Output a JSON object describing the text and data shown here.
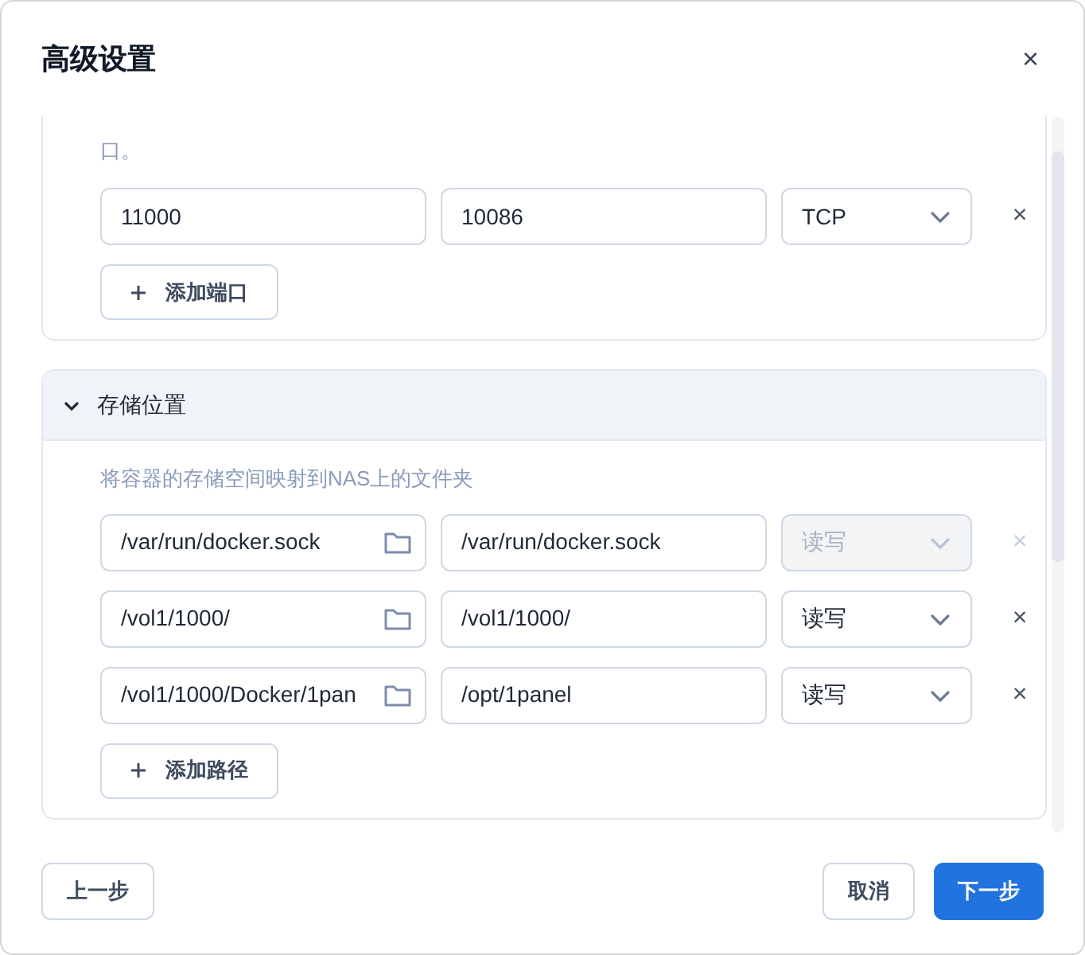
{
  "dialog": {
    "title": "高级设置",
    "close": "×"
  },
  "ports": {
    "description_tail": "口。",
    "rows": [
      {
        "local": "11000",
        "container": "10086",
        "protocol": "TCP",
        "disabled": false,
        "remove": "×"
      }
    ],
    "add_button": "添加端口"
  },
  "storage": {
    "title": "存储位置",
    "expanded": true,
    "description": "将容器的存储空间映射到NAS上的文件夹",
    "rows": [
      {
        "host_path": "/var/run/docker.sock",
        "container_path": "/var/run/docker.sock",
        "mode": "读写",
        "disabled": true,
        "remove": "×"
      },
      {
        "host_path": "/vol1/1000/",
        "container_path": "/vol1/1000/",
        "mode": "读写",
        "disabled": false,
        "remove": "×"
      },
      {
        "host_path": "/vol1/1000/Docker/1pan",
        "container_path": "/opt/1panel",
        "mode": "读写",
        "disabled": false,
        "remove": "×"
      }
    ],
    "add_button": "添加路径"
  },
  "footer": {
    "back": "上一步",
    "cancel": "取消",
    "next": "下一步"
  }
}
